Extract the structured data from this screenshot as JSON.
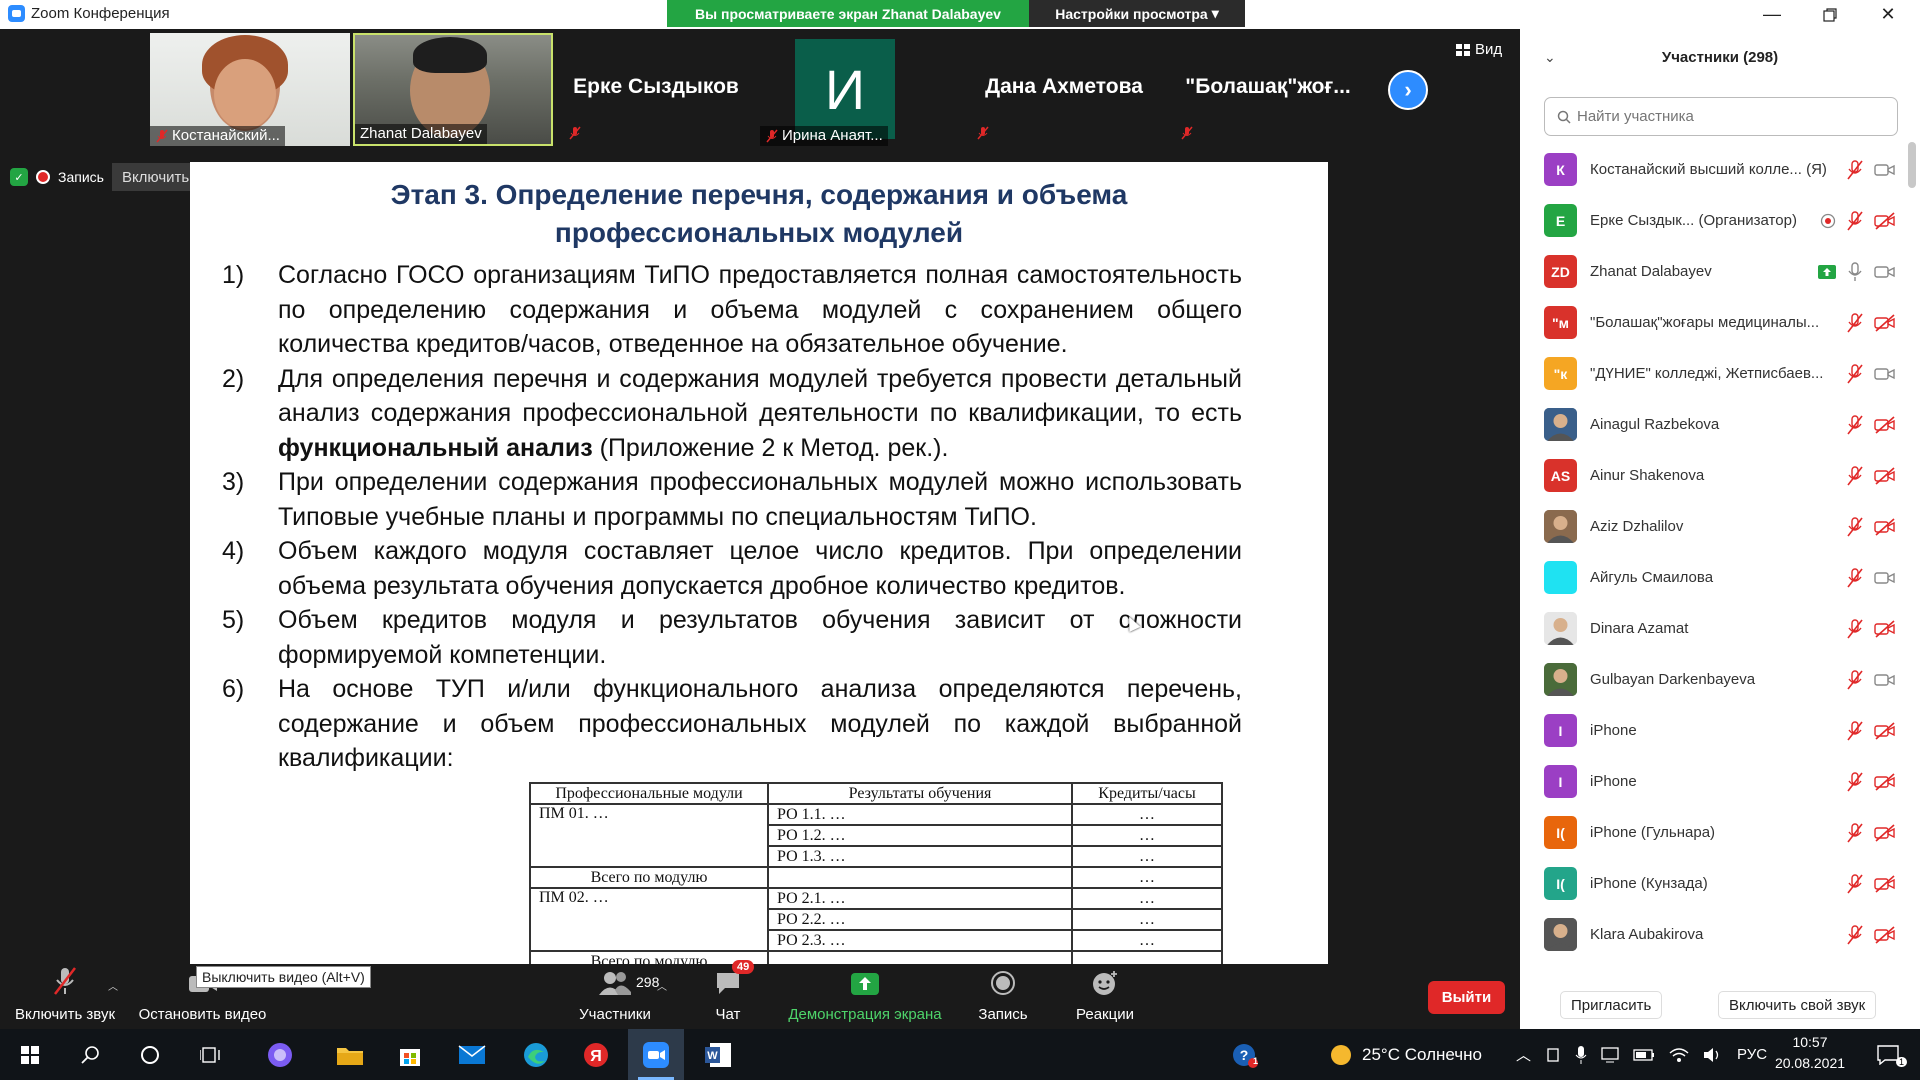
{
  "window": {
    "title": "Zoom Конференция",
    "share_banner": "Вы просматриваете экран Zhanat Dalabayev",
    "view_options": "Настройки просмотра"
  },
  "video_strip": {
    "tiles": [
      {
        "name": "Костанайский..."
      },
      {
        "name": "Zhanat Dalabayev"
      },
      {
        "big": "Ерке Сыздыков"
      },
      {
        "avatar_letter": "И",
        "name": "Ирина Анаят..."
      },
      {
        "big": "Дана Ахметова"
      },
      {
        "big": "\"Болашақ\"жоғ..."
      }
    ],
    "view_label": "Вид"
  },
  "status": {
    "recording": "Запись",
    "original_sound": "Включить оригинальный звук"
  },
  "slide": {
    "title_line1": "Этап 3. Определение перечня, содержания и объема",
    "title_line2": "профессиональных модулей",
    "items": [
      {
        "num": "1)",
        "text": "Согласно ГОСО организациям ТиПО предоставляется полная самостоятельность по определению содержания и объема модулей с сохранением общего количества кредитов/часов, отведенное на обязательное обучение."
      },
      {
        "num": "2)",
        "pre": "Для определения перечня и содержания модулей требуется провести детальный анализ содержания профессиональной деятельности по квалификации, то есть ",
        "bold": "функциональный анализ",
        "post": " (Приложение 2 к Метод. рек.)."
      },
      {
        "num": "3)",
        "text": "При определении содержания профессиональных модулей можно использовать Типовые учебные планы и программы по специальностям ТиПО."
      },
      {
        "num": "4)",
        "text": "Объем каждого модуля составляет целое число кредитов. При определении объема результата обучения допускается дробное количество кредитов."
      },
      {
        "num": "5)",
        "text": "Объем кредитов модуля и результатов обучения зависит от сложности формируемой компетенции."
      },
      {
        "num": "6)",
        "text": "На основе ТУП и/или функционального анализа определяются перечень, содержание и объем профессиональных модулей по каждой выбранной квалификации:"
      }
    ],
    "table": {
      "headers": [
        "Профессиональные модули",
        "Результаты обучения",
        "Кредиты/часы"
      ],
      "pm1": "ПМ 01. …",
      "pm2": "ПМ 02. …",
      "ro1": [
        "РО 1.1. …",
        "РО 1.2. …",
        "РО 1.3. …"
      ],
      "ro2": [
        "РО 2.1. …",
        "РО 2.2. …",
        "РО 2.3. …"
      ],
      "total": "Всего по модулю",
      "ellipsis": "…"
    }
  },
  "participants": {
    "header": "Участники (298)",
    "search_placeholder": "Найти участника",
    "list": [
      {
        "initials": "К",
        "color": "#9b3fc4",
        "name": "Костанайский высший колле... (Я)",
        "audio": "muted",
        "video": "on"
      },
      {
        "initials": "Е",
        "color": "#23a543",
        "name": "Ерке Сыздык... (Организатор)",
        "audio": "muted",
        "video": "off",
        "extra": "rec"
      },
      {
        "initials": "ZD",
        "color": "#d9322b",
        "name": "Zhanat Dalabayev",
        "audio": "on",
        "video": "on",
        "extra": "share"
      },
      {
        "initials": "\"м",
        "color": "#d9322b",
        "name": "\"Болашақ\"жоғары медициналы...",
        "audio": "muted",
        "video": "off"
      },
      {
        "initials": "\"к",
        "color": "#f5a623",
        "name": "\"ДҮНИЕ\" колледжі, Жетписбаев...",
        "audio": "muted",
        "video": "on"
      },
      {
        "initials": "",
        "color": "#3a5f8a",
        "name": "Ainagul Razbekova",
        "audio": "muted",
        "video": "off",
        "photo": true
      },
      {
        "initials": "AS",
        "color": "#d9322b",
        "name": "Ainur Shakenova",
        "audio": "muted",
        "video": "off"
      },
      {
        "initials": "",
        "color": "#8a6a4e",
        "name": "Aziz Dzhalilov",
        "audio": "muted",
        "video": "off",
        "photo": true
      },
      {
        "initials": "",
        "color": "#1fe2f2",
        "name": "Айгуль Смаилова",
        "audio": "muted",
        "video": "on"
      },
      {
        "initials": "",
        "color": "#e6e6e6",
        "name": "Dinara Azamat",
        "audio": "muted",
        "video": "off",
        "photo": true
      },
      {
        "initials": "",
        "color": "#4a6b3a",
        "name": "Gulbayan Darkenbayeva",
        "audio": "muted",
        "video": "on",
        "photo": true
      },
      {
        "initials": "I",
        "color": "#9b3fc4",
        "name": "iPhone",
        "audio": "muted",
        "video": "off"
      },
      {
        "initials": "I",
        "color": "#9b3fc4",
        "name": "iPhone",
        "audio": "muted",
        "video": "off"
      },
      {
        "initials": "I(",
        "color": "#e8660c",
        "name": "iPhone (Гульнара)",
        "audio": "muted",
        "video": "off"
      },
      {
        "initials": "I(",
        "color": "#23a58a",
        "name": "iPhone (Кунзада)",
        "audio": "muted",
        "video": "off"
      },
      {
        "initials": "",
        "color": "#555",
        "name": "Klara Aubakirova",
        "audio": "muted",
        "video": "off",
        "photo": true
      }
    ],
    "invite": "Пригласить",
    "unmute_me": "Включить свой звук"
  },
  "toolbar": {
    "unmute": "Включить звук",
    "stop_video": "Остановить видео",
    "tooltip": "Выключить видео (Alt+V)",
    "participants": "Участники",
    "participants_count": "298",
    "chat": "Чат",
    "chat_badge": "49",
    "share": "Демонстрация экрана",
    "record": "Запись",
    "reactions": "Реакции",
    "leave": "Выйти"
  },
  "taskbar": {
    "weather": "25°C Солнечно",
    "lang": "РУС",
    "time": "10:57",
    "date": "20.08.2021",
    "notif_count": "1"
  }
}
